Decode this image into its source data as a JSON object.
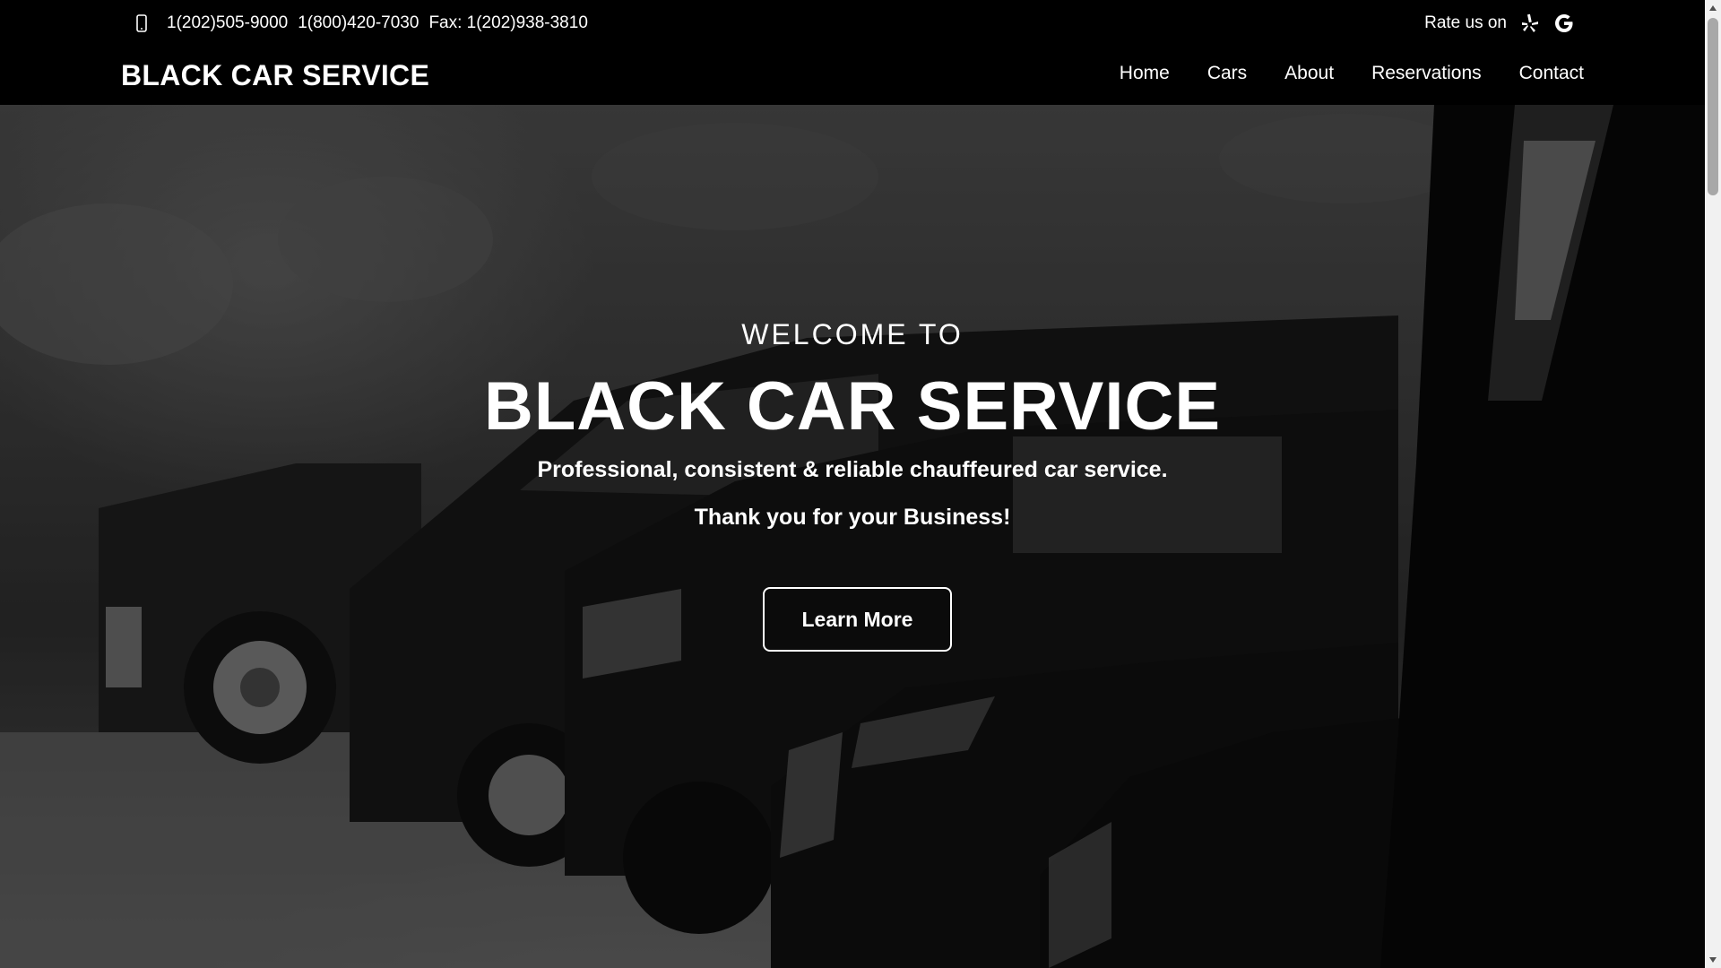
{
  "topbar": {
    "phones": [
      "1(202)505-9000",
      "1(800)420-7030",
      "Fax: 1(202)938-3810"
    ],
    "rate_label": "Rate us on",
    "icons": [
      "phone-icon",
      "yelp-icon",
      "google-icon"
    ]
  },
  "navbar": {
    "brand": "BLACK CAR SERVICE",
    "items": [
      {
        "label": "Home"
      },
      {
        "label": "Cars"
      },
      {
        "label": "About"
      },
      {
        "label": "Reservations"
      },
      {
        "label": "Contact"
      }
    ]
  },
  "hero": {
    "welcome": "WELCOME TO",
    "title": "BLACK CAR SERVICE",
    "tagline": "Professional, consistent & reliable chauffeured car service.",
    "thanks": "Thank you for your Business!",
    "button_label": "Learn More"
  },
  "colors": {
    "header_bg": "#000000",
    "text": "#ffffff",
    "scrollbar_track": "#f1f1f1",
    "scrollbar_thumb": "#a8a8a8"
  }
}
